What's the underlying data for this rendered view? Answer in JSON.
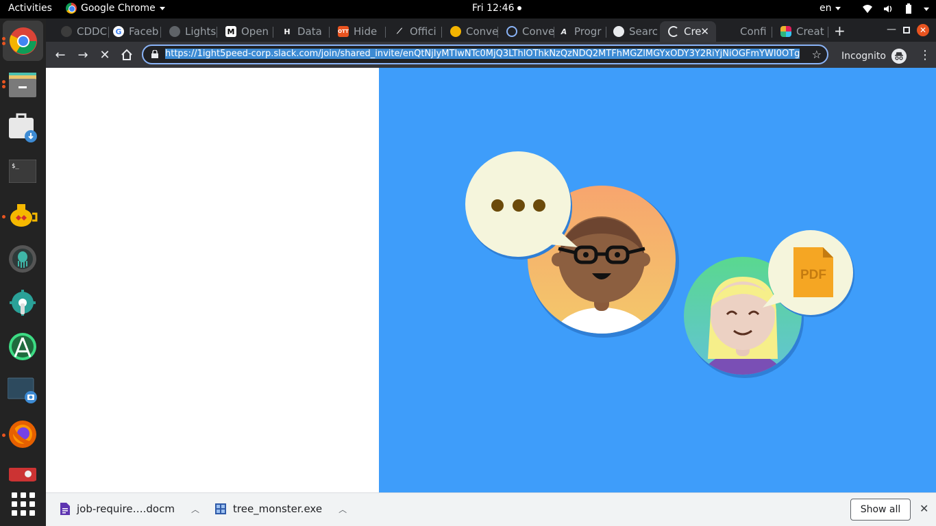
{
  "system_bar": {
    "activities": "Activities",
    "app_name": "Google Chrome",
    "clock": "Fri 12:46",
    "language": "en"
  },
  "dock": {
    "apps": [
      "Google Chrome",
      "Files",
      "Software Updater",
      "Terminal",
      "Teapot",
      "GitKraken",
      "Settings",
      "Android Studio",
      "Screenshot",
      "Firefox",
      "App"
    ],
    "show_apps_icon": "grid-icon"
  },
  "tabs": [
    {
      "label": "CDDC",
      "favicon": "cddc-icon"
    },
    {
      "label": "Faceb",
      "favicon": "google-icon"
    },
    {
      "label": "Lights",
      "favicon": "lights-icon"
    },
    {
      "label": "Open",
      "favicon": "medium-icon"
    },
    {
      "label": "Data",
      "favicon": "data-icon"
    },
    {
      "label": "Hide",
      "favicon": "hide-icon"
    },
    {
      "label": "Offici",
      "favicon": "official-icon"
    },
    {
      "label": "Conve",
      "favicon": "convert-icon"
    },
    {
      "label": "Conve",
      "favicon": "convert2-icon"
    },
    {
      "label": "Progr",
      "favicon": "progress-icon"
    },
    {
      "label": "Searc",
      "favicon": "github-icon"
    },
    {
      "label": "Cre",
      "favicon": "loading-icon",
      "active": true
    },
    {
      "label": "Confi",
      "favicon": "config-icon"
    },
    {
      "label": "Creat",
      "favicon": "slack-icon"
    }
  ],
  "toolbar": {
    "url": "https://1ight5peed-corp.slack.com/join/shared_invite/enQtNjIyMTIwNTc0MjQ3LThlOThkNzQzNDQ2MTFhMGZlMGYxODY3Y2RiYjNiOGFmYWI0OTg",
    "profile_label": "Incognito"
  },
  "hero": {
    "chat_bubble_text": "• • •",
    "pdf_label": "PDF",
    "colors": {
      "background": "#3e9dfa",
      "bubble": "#f5f5dc",
      "pdf": "#f5a623"
    }
  },
  "downloads": {
    "items": [
      {
        "name": "job-require….docm",
        "icon": "docm-icon"
      },
      {
        "name": "tree_monster.exe",
        "icon": "exe-icon"
      }
    ],
    "show_all": "Show all"
  }
}
